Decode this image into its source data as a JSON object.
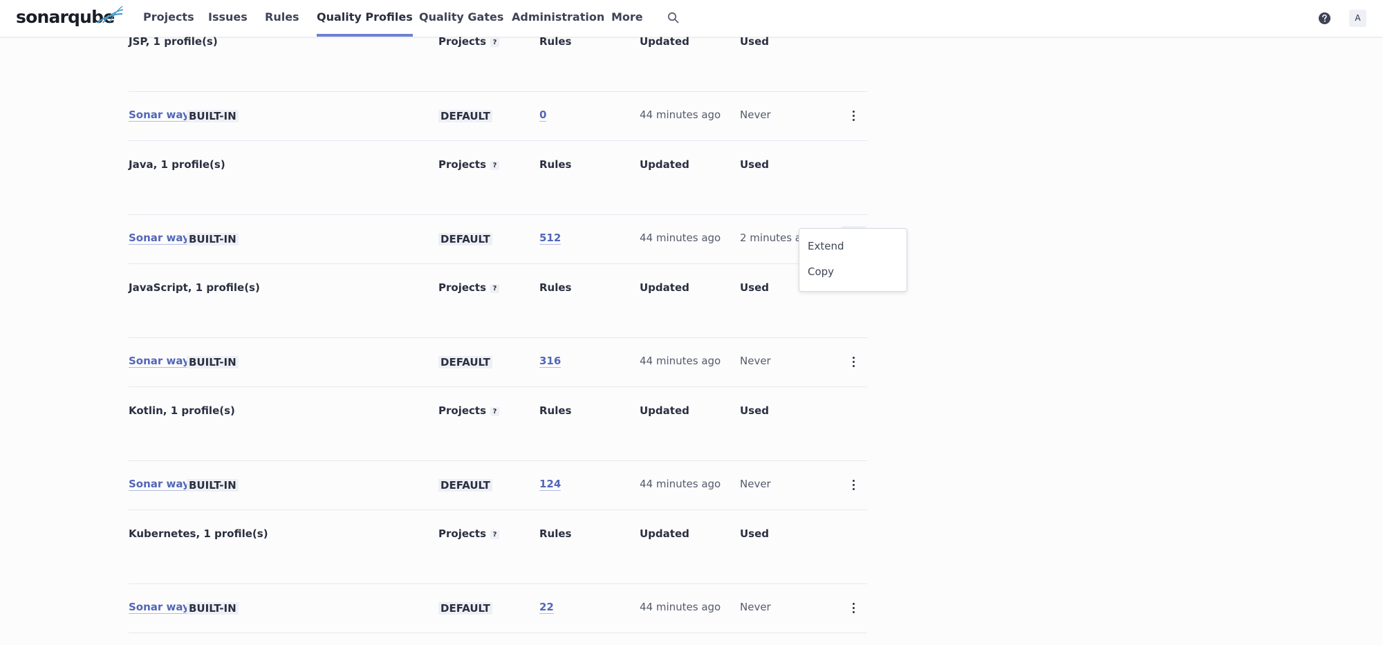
{
  "brand": {
    "logo_text": "sonarqube"
  },
  "nav": {
    "items": [
      {
        "label": "Projects"
      },
      {
        "label": "Issues"
      },
      {
        "label": "Rules"
      },
      {
        "label": "Quality Profiles"
      },
      {
        "label": "Quality Gates"
      },
      {
        "label": "Administration"
      },
      {
        "label": "More"
      }
    ],
    "active": "Quality Profiles",
    "user_initial": "A"
  },
  "table_headers": {
    "projects": "Projects",
    "projects_help": "?",
    "rules": "Rules",
    "updated": "Updated",
    "used": "Used"
  },
  "sections": [
    {
      "title": "JSP, 1 profile(s)",
      "profile": "Sonar way",
      "badge": "BUILT-IN",
      "default_badge": "DEFAULT",
      "rules": "0",
      "updated": "44 minutes ago",
      "used": "Never"
    },
    {
      "title": "Java, 1 profile(s)",
      "profile": "Sonar way",
      "badge": "BUILT-IN",
      "default_badge": "DEFAULT",
      "rules": "512",
      "updated": "44 minutes ago",
      "used": "2 minutes ago"
    },
    {
      "title": "JavaScript, 1 profile(s)",
      "profile": "Sonar way",
      "badge": "BUILT-IN",
      "default_badge": "DEFAULT",
      "rules": "316",
      "updated": "44 minutes ago",
      "used": "Never"
    },
    {
      "title": "Kotlin, 1 profile(s)",
      "profile": "Sonar way",
      "badge": "BUILT-IN",
      "default_badge": "DEFAULT",
      "rules": "124",
      "updated": "44 minutes ago",
      "used": "Never"
    },
    {
      "title": "Kubernetes, 1 profile(s)",
      "profile": "Sonar way",
      "badge": "BUILT-IN",
      "default_badge": "DEFAULT",
      "rules": "22",
      "updated": "44 minutes ago",
      "used": "Never"
    }
  ],
  "dropdown": {
    "items": [
      "Extend",
      "Copy"
    ]
  },
  "icons": {
    "search": "search-icon",
    "help": "help-icon",
    "more": "more-vertical-icon"
  },
  "colors": {
    "accent": "#6f80d3",
    "link": "#5266b9"
  }
}
